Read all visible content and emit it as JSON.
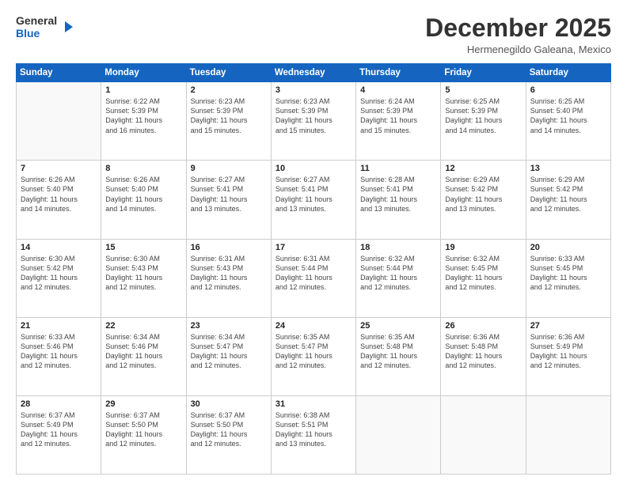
{
  "header": {
    "logo_line1": "General",
    "logo_line2": "Blue",
    "month": "December 2025",
    "location": "Hermenegildo Galeana, Mexico"
  },
  "days_of_week": [
    "Sunday",
    "Monday",
    "Tuesday",
    "Wednesday",
    "Thursday",
    "Friday",
    "Saturday"
  ],
  "weeks": [
    [
      {
        "day": "",
        "lines": []
      },
      {
        "day": "1",
        "lines": [
          "Sunrise: 6:22 AM",
          "Sunset: 5:39 PM",
          "Daylight: 11 hours",
          "and 16 minutes."
        ]
      },
      {
        "day": "2",
        "lines": [
          "Sunrise: 6:23 AM",
          "Sunset: 5:39 PM",
          "Daylight: 11 hours",
          "and 15 minutes."
        ]
      },
      {
        "day": "3",
        "lines": [
          "Sunrise: 6:23 AM",
          "Sunset: 5:39 PM",
          "Daylight: 11 hours",
          "and 15 minutes."
        ]
      },
      {
        "day": "4",
        "lines": [
          "Sunrise: 6:24 AM",
          "Sunset: 5:39 PM",
          "Daylight: 11 hours",
          "and 15 minutes."
        ]
      },
      {
        "day": "5",
        "lines": [
          "Sunrise: 6:25 AM",
          "Sunset: 5:39 PM",
          "Daylight: 11 hours",
          "and 14 minutes."
        ]
      },
      {
        "day": "6",
        "lines": [
          "Sunrise: 6:25 AM",
          "Sunset: 5:40 PM",
          "Daylight: 11 hours",
          "and 14 minutes."
        ]
      }
    ],
    [
      {
        "day": "7",
        "lines": [
          "Sunrise: 6:26 AM",
          "Sunset: 5:40 PM",
          "Daylight: 11 hours",
          "and 14 minutes."
        ]
      },
      {
        "day": "8",
        "lines": [
          "Sunrise: 6:26 AM",
          "Sunset: 5:40 PM",
          "Daylight: 11 hours",
          "and 14 minutes."
        ]
      },
      {
        "day": "9",
        "lines": [
          "Sunrise: 6:27 AM",
          "Sunset: 5:41 PM",
          "Daylight: 11 hours",
          "and 13 minutes."
        ]
      },
      {
        "day": "10",
        "lines": [
          "Sunrise: 6:27 AM",
          "Sunset: 5:41 PM",
          "Daylight: 11 hours",
          "and 13 minutes."
        ]
      },
      {
        "day": "11",
        "lines": [
          "Sunrise: 6:28 AM",
          "Sunset: 5:41 PM",
          "Daylight: 11 hours",
          "and 13 minutes."
        ]
      },
      {
        "day": "12",
        "lines": [
          "Sunrise: 6:29 AM",
          "Sunset: 5:42 PM",
          "Daylight: 11 hours",
          "and 13 minutes."
        ]
      },
      {
        "day": "13",
        "lines": [
          "Sunrise: 6:29 AM",
          "Sunset: 5:42 PM",
          "Daylight: 11 hours",
          "and 12 minutes."
        ]
      }
    ],
    [
      {
        "day": "14",
        "lines": [
          "Sunrise: 6:30 AM",
          "Sunset: 5:42 PM",
          "Daylight: 11 hours",
          "and 12 minutes."
        ]
      },
      {
        "day": "15",
        "lines": [
          "Sunrise: 6:30 AM",
          "Sunset: 5:43 PM",
          "Daylight: 11 hours",
          "and 12 minutes."
        ]
      },
      {
        "day": "16",
        "lines": [
          "Sunrise: 6:31 AM",
          "Sunset: 5:43 PM",
          "Daylight: 11 hours",
          "and 12 minutes."
        ]
      },
      {
        "day": "17",
        "lines": [
          "Sunrise: 6:31 AM",
          "Sunset: 5:44 PM",
          "Daylight: 11 hours",
          "and 12 minutes."
        ]
      },
      {
        "day": "18",
        "lines": [
          "Sunrise: 6:32 AM",
          "Sunset: 5:44 PM",
          "Daylight: 11 hours",
          "and 12 minutes."
        ]
      },
      {
        "day": "19",
        "lines": [
          "Sunrise: 6:32 AM",
          "Sunset: 5:45 PM",
          "Daylight: 11 hours",
          "and 12 minutes."
        ]
      },
      {
        "day": "20",
        "lines": [
          "Sunrise: 6:33 AM",
          "Sunset: 5:45 PM",
          "Daylight: 11 hours",
          "and 12 minutes."
        ]
      }
    ],
    [
      {
        "day": "21",
        "lines": [
          "Sunrise: 6:33 AM",
          "Sunset: 5:46 PM",
          "Daylight: 11 hours",
          "and 12 minutes."
        ]
      },
      {
        "day": "22",
        "lines": [
          "Sunrise: 6:34 AM",
          "Sunset: 5:46 PM",
          "Daylight: 11 hours",
          "and 12 minutes."
        ]
      },
      {
        "day": "23",
        "lines": [
          "Sunrise: 6:34 AM",
          "Sunset: 5:47 PM",
          "Daylight: 11 hours",
          "and 12 minutes."
        ]
      },
      {
        "day": "24",
        "lines": [
          "Sunrise: 6:35 AM",
          "Sunset: 5:47 PM",
          "Daylight: 11 hours",
          "and 12 minutes."
        ]
      },
      {
        "day": "25",
        "lines": [
          "Sunrise: 6:35 AM",
          "Sunset: 5:48 PM",
          "Daylight: 11 hours",
          "and 12 minutes."
        ]
      },
      {
        "day": "26",
        "lines": [
          "Sunrise: 6:36 AM",
          "Sunset: 5:48 PM",
          "Daylight: 11 hours",
          "and 12 minutes."
        ]
      },
      {
        "day": "27",
        "lines": [
          "Sunrise: 6:36 AM",
          "Sunset: 5:49 PM",
          "Daylight: 11 hours",
          "and 12 minutes."
        ]
      }
    ],
    [
      {
        "day": "28",
        "lines": [
          "Sunrise: 6:37 AM",
          "Sunset: 5:49 PM",
          "Daylight: 11 hours",
          "and 12 minutes."
        ]
      },
      {
        "day": "29",
        "lines": [
          "Sunrise: 6:37 AM",
          "Sunset: 5:50 PM",
          "Daylight: 11 hours",
          "and 12 minutes."
        ]
      },
      {
        "day": "30",
        "lines": [
          "Sunrise: 6:37 AM",
          "Sunset: 5:50 PM",
          "Daylight: 11 hours",
          "and 12 minutes."
        ]
      },
      {
        "day": "31",
        "lines": [
          "Sunrise: 6:38 AM",
          "Sunset: 5:51 PM",
          "Daylight: 11 hours",
          "and 13 minutes."
        ]
      },
      {
        "day": "",
        "lines": []
      },
      {
        "day": "",
        "lines": []
      },
      {
        "day": "",
        "lines": []
      }
    ]
  ]
}
